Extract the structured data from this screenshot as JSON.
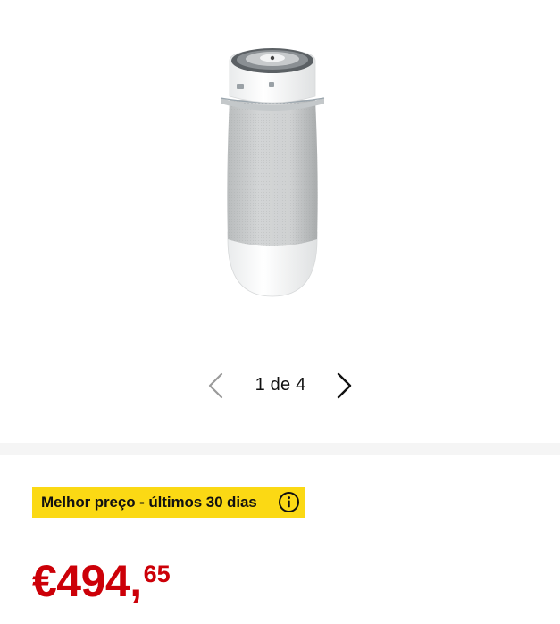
{
  "gallery": {
    "product_image_icon": "portable-air-conditioner-image",
    "pager": {
      "current": 1,
      "total": 4,
      "label": "1 de 4",
      "prev_icon": "chevron-left-icon",
      "next_icon": "chevron-right-icon"
    }
  },
  "badge": {
    "label": "Melhor preço - últimos 30 dias",
    "info_icon": "info-icon",
    "background": "#fbd914"
  },
  "price": {
    "currency_and_whole": "€494,",
    "cents": "65",
    "color": "#cc0008"
  }
}
